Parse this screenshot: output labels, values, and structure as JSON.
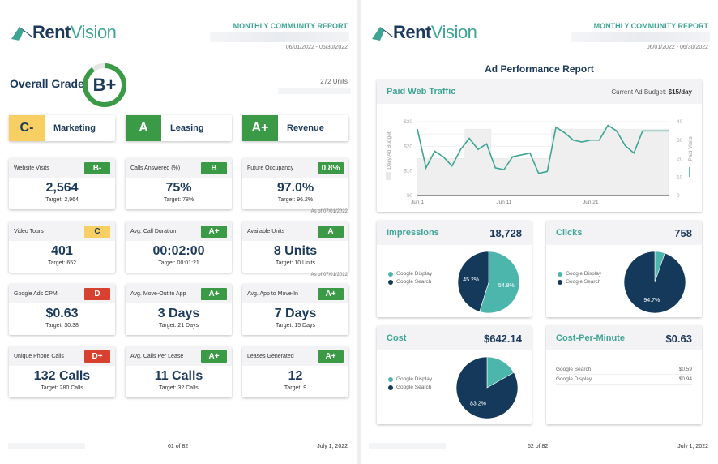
{
  "brand": {
    "name_part1": "Rent",
    "name_part2": "Vision",
    "primary": "#1b3a5c",
    "accent": "#3ea595"
  },
  "colors": {
    "green": "#3a9a45",
    "yellow": "#f8cf62",
    "red": "#d8412f",
    "teal": "#4db6ac",
    "navy": "#14395b"
  },
  "left_page": {
    "report_title": "MONTHLY COMMUNITY REPORT",
    "date_range": "06/01/2022 - 06/30/2022",
    "overall_label": "Overall Grade:",
    "overall_grade": "B+",
    "overall_score_fraction": 0.9,
    "units": "272 Units",
    "categories": [
      {
        "grade": "C-",
        "label": "Marketing",
        "color": "yellow"
      },
      {
        "grade": "A",
        "label": "Leasing",
        "color": "green"
      },
      {
        "grade": "A+",
        "label": "Revenue",
        "color": "green"
      }
    ],
    "metrics": [
      {
        "name": "Website Visits",
        "badge": "B-",
        "color": "green",
        "value": "2,564",
        "target": "Target: 2,964"
      },
      {
        "name": "Calls Answered (%)",
        "badge": "B",
        "color": "green",
        "value": "75%",
        "target": "Target: 78%"
      },
      {
        "name": "Future Occupancy",
        "badge": "0.8%",
        "color": "green",
        "value": "97.0%",
        "target": "Target: 96.2%"
      },
      {
        "name": "Video Tours",
        "badge": "C",
        "color": "yellow",
        "value": "401",
        "target": "Target: 652"
      },
      {
        "name": "Avg. Call Duration",
        "badge": "A+",
        "color": "green",
        "value": "00:02:00",
        "target": "Target: 00:01:21"
      },
      {
        "name": "Available Units",
        "badge": "A",
        "color": "green",
        "value": "8 Units",
        "target": "Target: 10 Units"
      },
      {
        "name": "Google Ads CPM",
        "badge": "D",
        "color": "red",
        "value": "$0.63",
        "target": "Target: $0.38"
      },
      {
        "name": "Avg. Move-Out to App",
        "badge": "A+",
        "color": "green",
        "value": "3 Days",
        "target": "Target: 21 Days"
      },
      {
        "name": "Avg. App to Move-In",
        "badge": "A+",
        "color": "green",
        "value": "7 Days",
        "target": "Target: 15 Days"
      },
      {
        "name": "Unique Phone Calls",
        "badge": "D+",
        "color": "red",
        "value": "132 Calls",
        "target": "Target: 280 Calls"
      },
      {
        "name": "Avg. Calls Per Lease",
        "badge": "A+",
        "color": "green",
        "value": "11 Calls",
        "target": "Target: 32 Calls"
      },
      {
        "name": "Leases Generated",
        "badge": "A+",
        "color": "green",
        "value": "12",
        "target": "Target: 9"
      }
    ],
    "as_of_1": "As of 07/01/2022",
    "as_of_2": "As of 07/01/2022",
    "page_number": "61 of 82",
    "footer_date": "July 1, 2022"
  },
  "right_page": {
    "report_title": "MONTHLY COMMUNITY REPORT",
    "date_range": "06/01/2022 - 06/30/2022",
    "title": "Ad Performance Report",
    "paid_web_traffic": {
      "title": "Paid Web Traffic",
      "budget_label": "Current Ad Budget:",
      "budget_value": "$15/day"
    },
    "impressions": {
      "title": "Impressions",
      "value": "18,728"
    },
    "clicks": {
      "title": "Clicks",
      "value": "758"
    },
    "cost": {
      "title": "Cost",
      "value": "$642.14"
    },
    "cpm": {
      "title": "Cost-Per-Minute",
      "value": "$0.63",
      "rows": [
        {
          "label": "Google Search",
          "value": "$0.59"
        },
        {
          "label": "Google Display",
          "value": "$0.94"
        }
      ]
    },
    "legend": {
      "display": "Google Display",
      "search": "Google Search"
    },
    "page_number": "62 of 82",
    "footer_date": "July 1, 2022"
  },
  "chart_data": [
    {
      "type": "line",
      "title": "Paid Web Traffic",
      "x": [
        "Jun 1",
        "Jun 2",
        "Jun 3",
        "Jun 4",
        "Jun 5",
        "Jun 6",
        "Jun 7",
        "Jun 8",
        "Jun 9",
        "Jun 10",
        "Jun 11",
        "Jun 12",
        "Jun 13",
        "Jun 14",
        "Jun 15",
        "Jun 16",
        "Jun 17",
        "Jun 18",
        "Jun 19",
        "Jun 20",
        "Jun 21",
        "Jun 22",
        "Jun 23",
        "Jun 24",
        "Jun 25",
        "Jun 26",
        "Jun 27",
        "Jun 28",
        "Jun 29",
        "Jun 30"
      ],
      "x_tick_labels": [
        "Jun 1",
        "Jun 11",
        "Jun 21"
      ],
      "series": [
        {
          "name": "Daily Ad Budget",
          "type": "area",
          "axis": "left",
          "values": [
            15,
            15,
            15,
            15,
            15,
            15,
            27,
            27,
            27,
            15,
            15,
            15,
            15,
            15,
            15,
            15,
            27,
            27,
            27,
            27,
            27,
            27,
            27,
            27,
            27,
            27,
            27,
            27,
            27,
            27
          ]
        },
        {
          "name": "Paid Visits",
          "type": "line",
          "axis": "right",
          "values": [
            36,
            15,
            24,
            21,
            16,
            25,
            31,
            25,
            28,
            15,
            14,
            21,
            22,
            23,
            12,
            13,
            37,
            34,
            30,
            29,
            30,
            30,
            38,
            35,
            27,
            23,
            35,
            35,
            35,
            35
          ]
        }
      ],
      "ylabel_left": "Daily Ad Budget",
      "ylim_left": [
        0,
        30
      ],
      "yticks_left": [
        "$0",
        "$10",
        "$20",
        "$30"
      ],
      "ylabel_right": "Paid Visits",
      "ylim_right": [
        0,
        40
      ],
      "yticks_right": [
        "0",
        "10",
        "20",
        "30",
        "40"
      ],
      "grid": true
    },
    {
      "type": "pie",
      "title": "Impressions",
      "labels": [
        "Google Display",
        "Google Search"
      ],
      "values": [
        54.8,
        45.2
      ],
      "value_labels": [
        "54.8%",
        "45.2%"
      ]
    },
    {
      "type": "pie",
      "title": "Clicks",
      "labels": [
        "Google Display",
        "Google Search"
      ],
      "values": [
        5.3,
        94.7
      ],
      "value_labels": [
        "",
        "94.7%"
      ]
    },
    {
      "type": "pie",
      "title": "Cost",
      "labels": [
        "Google Display",
        "Google Search"
      ],
      "values": [
        16.8,
        83.2
      ],
      "value_labels": [
        "",
        "83.2%"
      ]
    }
  ]
}
